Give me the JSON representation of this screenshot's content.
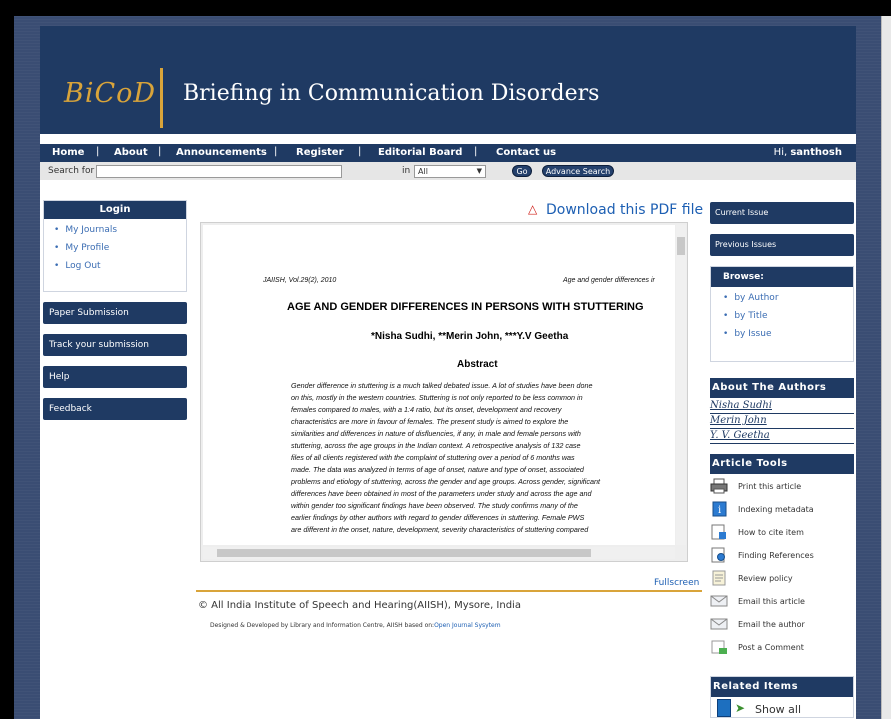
{
  "site": {
    "logo": "BiCoD",
    "title": "Briefing in Communication Disorders"
  },
  "nav": {
    "items": [
      "Home",
      "About",
      "Announcements",
      "Register",
      "Editorial Board",
      "Contact us"
    ],
    "greeting_prefix": "Hi, ",
    "user": "santhosh"
  },
  "search": {
    "label": "Search for",
    "value": "",
    "in_label": "in",
    "in_selected": "All",
    "go_label": "Go",
    "advanced_label": "Advance Search"
  },
  "login": {
    "title": "Login",
    "items": [
      "My Journals",
      "My Profile",
      "Log Out"
    ]
  },
  "left_buttons": [
    "Paper Submission",
    "Track your submission",
    "Help",
    "Feedback"
  ],
  "pdf": {
    "download_label": "Download this PDF file",
    "header_left": "JAIISH, Vol.29(2), 2010",
    "header_right": "Age and gender differences ir",
    "title": "AGE AND GENDER DIFFERENCES IN PERSONS WITH STUTTERING",
    "authors": "*Nisha Sudhi, **Merin John, ***Y.V Geetha",
    "abstract_heading": "Abstract",
    "abstract_lines": [
      "Gender difference in stuttering is a much talked debated issue. A lot of studies have been done",
      "on this, mostly in the western countries. Stuttering is not only reported to be less common in",
      "females compared to males, with a 1:4 ratio, but its onset, development and recovery",
      "characteristics are more in favour of females. The present study is aimed to explore the",
      "similarities and differences in nature of disfluencies, if any, in male and female persons with",
      "stuttering, across the age groups in the Indian context. A retrospective analysis of 132 case",
      "files of all clients registered with the complaint of stuttering over a period of 6 months was",
      "made. The data was analyzed in terms of age of onset, nature and type of onset, associated",
      "problems and etiology of stuttering, across the gender and age groups. Across gender, significant",
      "differences have been obtained in most of the parameters under study and across the age and",
      "within gender too significant findings have been observed. The study confirms many of the",
      "earlier findings by other authors with regard to gender differences in stuttering. Female PWS",
      "are different in the onset, nature, development, severity characteristics of stuttering compared"
    ],
    "fullscreen_label": "Fullscreen"
  },
  "footer": {
    "copyright": "© All India Institute of Speech and Hearing(AIISH), Mysore, India",
    "designed_prefix": "Designed & Developed by Library and Information Centre, AIISH based on:",
    "designed_link": "Open Journal Sysytem"
  },
  "right": {
    "current_issue": "Current Issue",
    "previous_issues": "Previous Issues",
    "browse_title": "Browse:",
    "browse_items": [
      "by Author",
      "by Title",
      "by Issue"
    ],
    "about_authors_title": "About The Authors",
    "authors": [
      "Nisha Sudhi",
      "Merin John",
      "Y. V. Geetha"
    ],
    "article_tools_title": "Article Tools",
    "tools": [
      {
        "label": "Print this article",
        "icon": "printer-icon"
      },
      {
        "label": "Indexing metadata",
        "icon": "info-icon"
      },
      {
        "label": "How to cite item",
        "icon": "cite-icon"
      },
      {
        "label": "Finding References",
        "icon": "search-doc-icon"
      },
      {
        "label": "Review policy",
        "icon": "review-icon"
      },
      {
        "label": "Email this article",
        "icon": "email-icon"
      },
      {
        "label": "Email the author",
        "icon": "email-author-icon"
      },
      {
        "label": "Post a Comment",
        "icon": "comment-icon"
      }
    ],
    "related_title": "Related Items",
    "show_all": "Show all"
  }
}
